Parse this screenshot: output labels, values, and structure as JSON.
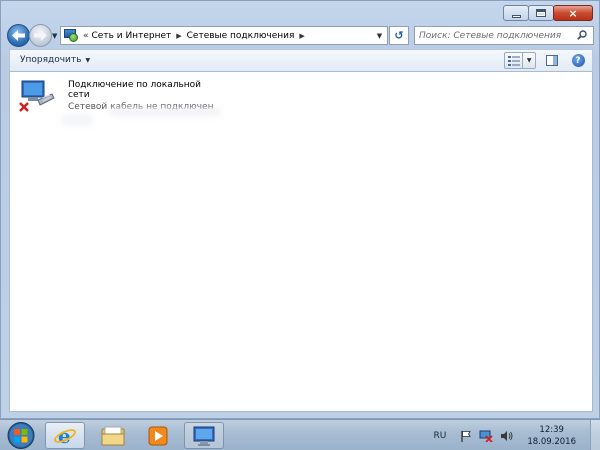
{
  "window": {
    "caption_buttons": {
      "minimize_icon": "minimize-icon",
      "maximize_icon": "maximize-icon",
      "close_glyph": "×"
    }
  },
  "nav": {
    "back_icon": "back-arrow-icon",
    "forward_icon": "forward-arrow-icon",
    "breadcrumb_overflow": "«",
    "breadcrumb": [
      {
        "label": "Сеть и Интернет"
      },
      {
        "label": "Сетевые подключения"
      }
    ],
    "separator": "▶",
    "dropdown_glyph": "▼",
    "refresh_glyph": "↺"
  },
  "search": {
    "placeholder": "Поиск: Сетевые подключения"
  },
  "toolbar": {
    "organize_label": "Упорядочить",
    "dropdown_glyph": "▼"
  },
  "connections": [
    {
      "name": "Подключение по локальной сети",
      "status": "Сетевой кабель не подключен",
      "icon": "network-adapter-disconnected-icon"
    }
  ],
  "taskbar": {
    "pinned": [
      {
        "name": "internet-explorer-icon",
        "state": "active"
      },
      {
        "name": "explorer-folder-icon",
        "state": "pinned"
      },
      {
        "name": "media-player-icon",
        "state": "pinned"
      },
      {
        "name": "network-connections-icon",
        "state": "open"
      }
    ],
    "language": "RU",
    "time": "12:39",
    "date": "18.09.2016"
  },
  "colors": {
    "window_frame": "#c4d6ec",
    "close_button": "#c84a2e",
    "link_blue": "#1d5aa5"
  }
}
